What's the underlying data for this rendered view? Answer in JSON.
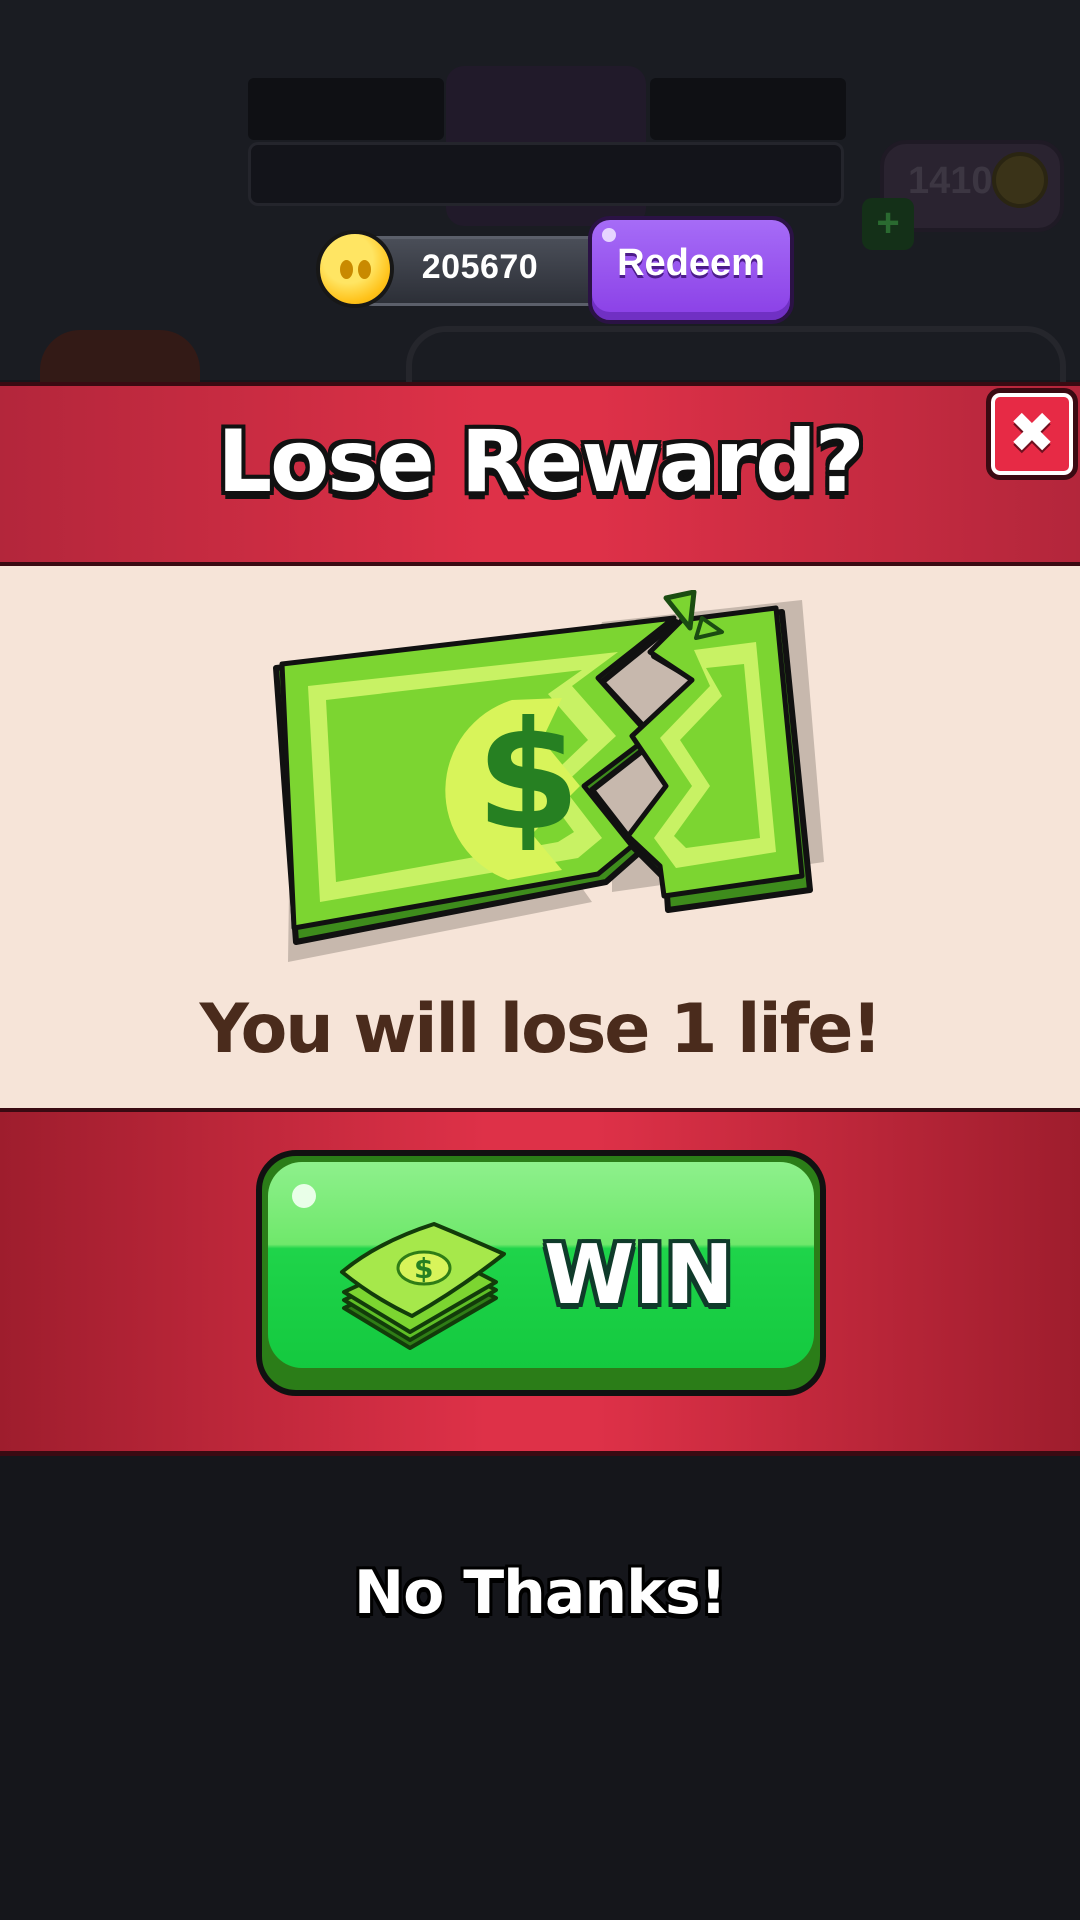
{
  "hud": {
    "coin_balance": "205670",
    "redeem_label": "Redeem",
    "lives_count": "1410",
    "plus_symbol": "+"
  },
  "dialog": {
    "title": "Lose Reward?",
    "close_icon": "✖",
    "illustration": "broken-dollar-bill-icon",
    "message": "You will lose 1 life!",
    "win_button_label": "WIN",
    "win_button_icon": "cash-stack-icon",
    "no_thanks_label": "No Thanks!"
  },
  "colors": {
    "dialog_red": "#de3148",
    "dialog_body": "#f6e4d8",
    "win_green": "#1fd44a",
    "redeem_purple": "#8a3fe6",
    "message_brown": "#4a2b1c"
  }
}
